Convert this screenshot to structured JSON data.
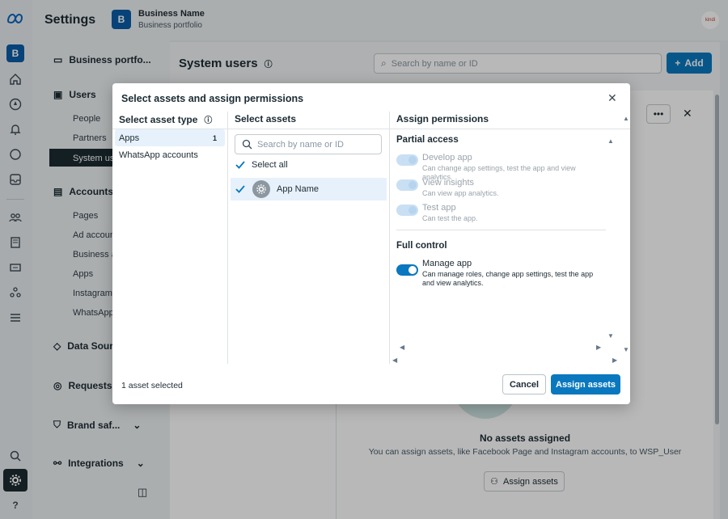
{
  "app": {
    "title": "Settings",
    "portfolio_initial": "B",
    "business_name": "Business Name",
    "business_sub": "Business portfolio",
    "profile_initials": "kindi"
  },
  "nav": {
    "business_portfolio": "Business portfo...",
    "users": "Users",
    "users_items": [
      "People",
      "Partners",
      "System use"
    ],
    "accounts": "Accounts",
    "accounts_items": [
      "Pages",
      "Ad account",
      "Business as",
      "Apps",
      "Instagram a",
      "WhatsApp"
    ],
    "data_sources": "Data Sour",
    "requests": "Requests",
    "brand_safety": "Brand saf...",
    "integrations": "Integrations"
  },
  "main": {
    "title": "System users",
    "search_placeholder": "Search by name or ID",
    "add_label": "Add",
    "empty_title": "No assets assigned",
    "empty_desc": "You can assign assets, like Facebook Page and Instagram accounts, to WSP_User",
    "assign_assets_label": "Assign assets"
  },
  "modal": {
    "title": "Select assets and assign permissions",
    "col1_header": "Select asset type",
    "asset_types": [
      {
        "label": "Apps",
        "count": "1"
      },
      {
        "label": "WhatsApp accounts",
        "count": ""
      }
    ],
    "col2_header": "Select assets",
    "asset_search_placeholder": "Search by name or ID",
    "select_all_label": "Select all",
    "asset_item": "App Name",
    "col3_header": "Assign permissions",
    "partial_access": "Partial access",
    "partial_perms": [
      {
        "title": "Develop app",
        "desc": "Can change app settings, test the app and view analytics."
      },
      {
        "title": "View insights",
        "desc": "Can view app analytics."
      },
      {
        "title": "Test app",
        "desc": "Can test the app."
      }
    ],
    "full_control": "Full control",
    "full_perm": {
      "title": "Manage app",
      "desc": "Can manage roles, change app settings, test the app and view analytics."
    },
    "footer_status": "1 asset selected",
    "cancel_label": "Cancel",
    "assign_label": "Assign assets"
  },
  "colors": {
    "accent": "#0a78be",
    "accent_dark": "#0064a8"
  }
}
